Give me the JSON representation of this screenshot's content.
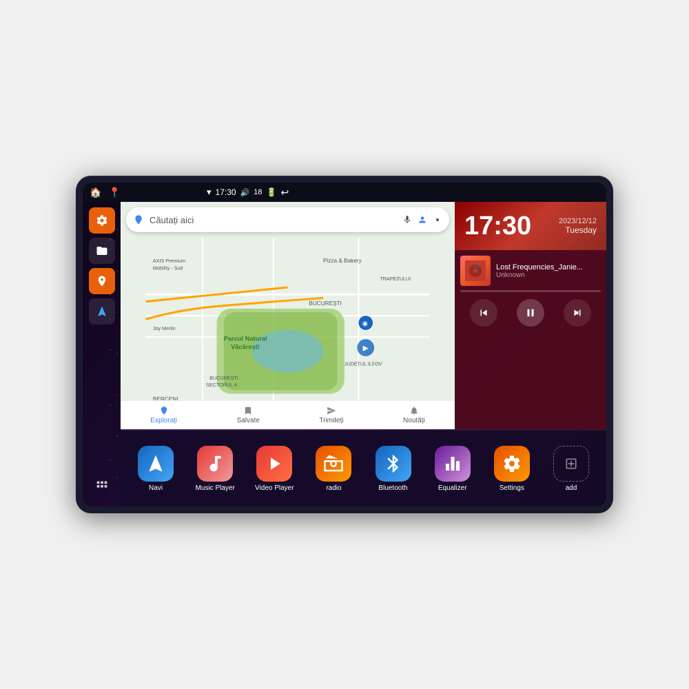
{
  "device": {
    "status_bar": {
      "wifi_icon": "▾",
      "time": "17:30",
      "volume_icon": "🔊",
      "battery_level": "18",
      "battery_icon": "🔋",
      "back_icon": "↩"
    },
    "sidebar": {
      "home_icon": "🏠",
      "map_icon": "📍",
      "settings_icon": "⚙",
      "folder_icon": "📁",
      "location_icon": "📍",
      "nav_icon": "▲",
      "grid_icon": "⋮⋮"
    },
    "map": {
      "search_placeholder": "Căutați aici",
      "map_label": "Parcul Natural Văcărești",
      "area1": "BUCUREȘTI",
      "area2": "BUCUREȘTI SECTORUL 4",
      "area3": "BERCENI",
      "area4": "JUDEȚUL ILFOV",
      "area5": "TRAPEZULUI",
      "poi1": "AXIS Premium Mobility - Sud",
      "poi2": "Pizza & Bakery",
      "poi3": "Joy Merlin",
      "bottom_explore": "Explorați",
      "bottom_saved": "Salvate",
      "bottom_send": "Trimiteți",
      "bottom_news": "Noutăți"
    },
    "clock": {
      "time": "17:30",
      "date": "2023/12/12",
      "day": "Tuesday"
    },
    "music": {
      "title": "Lost Frequencies_Janie...",
      "artist": "Unknown",
      "album_art_emoji": "🎵"
    },
    "apps": [
      {
        "id": "navi",
        "label": "Navi",
        "icon_class": "icon-navi",
        "icon": "▲"
      },
      {
        "id": "music-player",
        "label": "Music Player",
        "icon_class": "icon-music",
        "icon": "♫"
      },
      {
        "id": "video-player",
        "label": "Video Player",
        "icon_class": "icon-video",
        "icon": "▶"
      },
      {
        "id": "radio",
        "label": "radio",
        "icon_class": "icon-radio",
        "icon": "📻"
      },
      {
        "id": "bluetooth",
        "label": "Bluetooth",
        "icon_class": "icon-bluetooth",
        "icon": "⬡"
      },
      {
        "id": "equalizer",
        "label": "Equalizer",
        "icon_class": "icon-eq",
        "icon": "⚡"
      },
      {
        "id": "settings",
        "label": "Settings",
        "icon_class": "icon-settings",
        "icon": "⚙"
      },
      {
        "id": "add",
        "label": "add",
        "icon_class": "icon-add",
        "icon": "+"
      }
    ]
  }
}
